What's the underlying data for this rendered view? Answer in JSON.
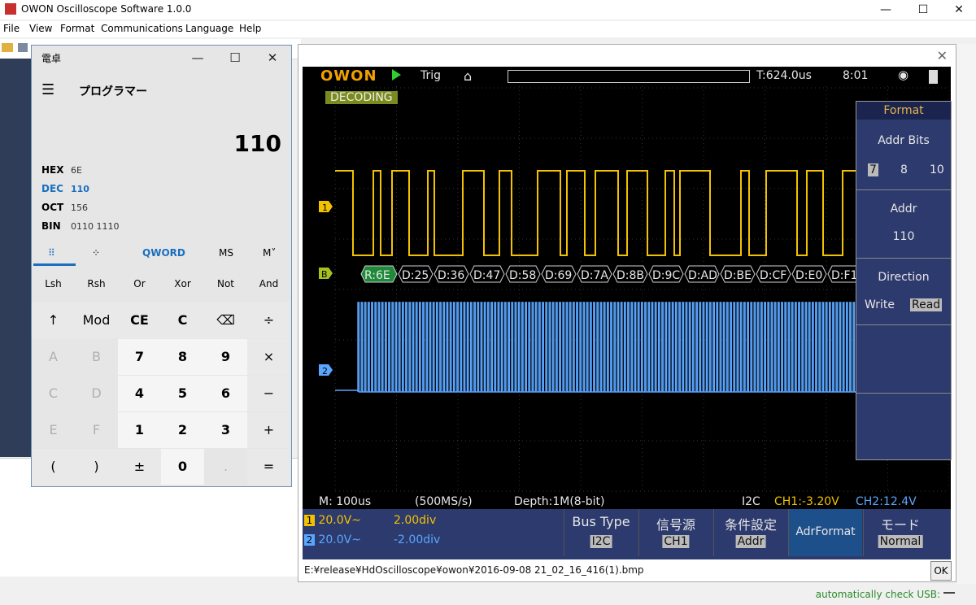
{
  "app": {
    "title": "OWON Oscilloscope Software 1.0.0",
    "minimize": "—",
    "maximize": "☐",
    "close": "✕"
  },
  "menu": [
    "File",
    "View",
    "Format",
    "Communications",
    "Language",
    "Help"
  ],
  "status": {
    "usb": "automatically check USB:"
  },
  "calculator": {
    "title": "電卓",
    "mode": "プログラマー",
    "display": "110",
    "radix": [
      {
        "name": "HEX",
        "value": "6E"
      },
      {
        "name": "DEC",
        "value": "110"
      },
      {
        "name": "OCT",
        "value": "156"
      },
      {
        "name": "BIN",
        "value": "0110 1110"
      }
    ],
    "tabs": {
      "word": "QWORD",
      "ms": "MS",
      "mplus": "M˅"
    },
    "fn_keys": [
      "Lsh",
      "Rsh",
      "Or",
      "Xor",
      "Not",
      "And"
    ],
    "keys": [
      [
        "↑",
        "Mod",
        "CE",
        "C",
        "⌫",
        "÷"
      ],
      [
        "A",
        "B",
        "7",
        "8",
        "9",
        "×"
      ],
      [
        "C",
        "D",
        "4",
        "5",
        "6",
        "−"
      ],
      [
        "E",
        "F",
        "1",
        "2",
        "3",
        "+"
      ],
      [
        "(",
        ")",
        "±",
        "0",
        ".",
        "="
      ]
    ]
  },
  "scope": {
    "logo": "OWON",
    "trig": "Trig",
    "time": "T:624.0us",
    "clock": "8:01",
    "decoding": "DECODING",
    "decode_labels": [
      "R:6E",
      "D:25",
      "D:36",
      "D:47",
      "D:58",
      "D:69",
      "D:7A",
      "D:8B",
      "D:9C",
      "D:AD",
      "D:BE",
      "D:CF",
      "D:E0",
      "D:F1"
    ],
    "channel_markers": {
      "ch1": "1",
      "bus": "B",
      "ch2": "2"
    },
    "format_panel": {
      "title": "Format",
      "addr_bits_label": "Addr  Bits",
      "addr_bits_options": [
        "7",
        "8",
        "10"
      ],
      "addr_bits_selected": "7",
      "addr_label": "Addr",
      "addr_value": "110",
      "direction_label": "Direction",
      "direction_options": [
        "Write",
        "Read"
      ],
      "direction_selected": "Read"
    },
    "status": {
      "memory": "M: 100us",
      "rate": "(500MS/s)",
      "depth": "Depth:1M(8-bit)",
      "bus": "I2C",
      "ch1": "CH1:-3.20V",
      "ch2": "CH2:12.4V"
    },
    "channels": [
      {
        "id": "1",
        "volts": "20.0V~",
        "div": "2.00div",
        "color": "#f2c200"
      },
      {
        "id": "2",
        "volts": "20.0V~",
        "div": "-2.00div",
        "color": "#5aa6ff"
      }
    ],
    "menu_buttons": [
      {
        "label": "Bus Type",
        "value": "I2C"
      },
      {
        "label": "信号源",
        "value": "CH1"
      },
      {
        "label": "条件設定",
        "value": "Addr"
      },
      {
        "label": "AdrFormat",
        "value": ""
      },
      {
        "label": "モード",
        "value": "Normal"
      }
    ],
    "file_path": "E:¥release¥HdOscilloscope¥owon¥2016-09-08 21_02_16_416(1).bmp",
    "ok": "OK",
    "close": "✕"
  },
  "colors": {
    "ch1": "#f2c200",
    "ch2": "#5aa6ff",
    "decode_green": "#1f8a3a",
    "menu_bg": "#2d3a6d"
  }
}
